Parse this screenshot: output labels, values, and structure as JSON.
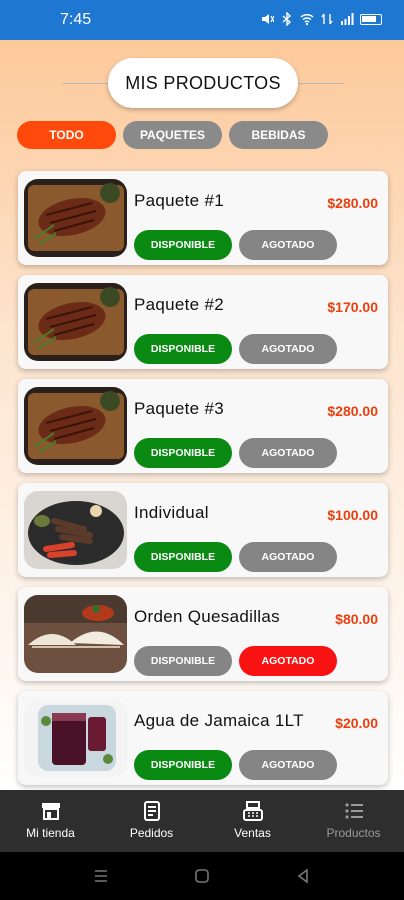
{
  "status_bar": {
    "time": "7:45",
    "color": "#1e78d2"
  },
  "header": {
    "title": "MIS PRODUCTOS"
  },
  "tabs": [
    {
      "label": "TODO",
      "active": true
    },
    {
      "label": "PAQUETES",
      "active": false
    },
    {
      "label": "BEBIDAS",
      "active": false
    }
  ],
  "products": [
    {
      "name": "Paquete #1",
      "price": "$280.00",
      "image": "steak-board-image",
      "available_label": "DISPONIBLE",
      "soldout_label": "AGOTADO",
      "status": "disponible"
    },
    {
      "name": "Paquete #2",
      "price": "$170.00",
      "image": "steak-board-image",
      "available_label": "DISPONIBLE",
      "soldout_label": "AGOTADO",
      "status": "disponible"
    },
    {
      "name": "Paquete #3",
      "price": "$280.00",
      "image": "steak-board-image",
      "available_label": "DISPONIBLE",
      "soldout_label": "AGOTADO",
      "status": "disponible"
    },
    {
      "name": "Individual",
      "price": "$100.00",
      "image": "grill-plate-image",
      "available_label": "DISPONIBLE",
      "soldout_label": "AGOTADO",
      "status": "disponible"
    },
    {
      "name": "Orden Quesadillas",
      "price": "$80.00",
      "image": "quesadillas-image",
      "available_label": "DISPONIBLE",
      "soldout_label": "AGOTADO",
      "status": "agotado"
    },
    {
      "name": "Agua de Jamaica 1LT",
      "price": "$20.00",
      "image": "jamaica-drink-image",
      "available_label": "DISPONIBLE",
      "soldout_label": "AGOTADO",
      "status": "disponible"
    }
  ],
  "bottom_nav": [
    {
      "label": "Mi tienda",
      "icon": "store-icon",
      "active": true
    },
    {
      "label": "Pedidos",
      "icon": "receipt-icon",
      "active": true
    },
    {
      "label": "Ventas",
      "icon": "cash-register-icon",
      "active": true
    },
    {
      "label": "Productos",
      "icon": "list-icon",
      "active": false
    }
  ],
  "colors": {
    "accent": "#ff4a0c",
    "price": "#e8400e",
    "available": "#0a8a12",
    "soldout": "#f81212",
    "inactive": "#858585"
  }
}
